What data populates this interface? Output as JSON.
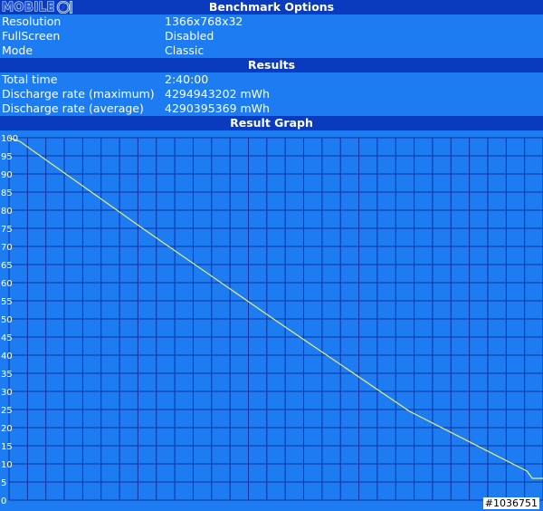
{
  "logo": {
    "text": "MOBILE"
  },
  "benchmark_options": {
    "header": "Benchmark Options",
    "rows": [
      {
        "label": "Resolution",
        "value": "1366x768x32"
      },
      {
        "label": "FullScreen",
        "value": "Disabled"
      },
      {
        "label": "Mode",
        "value": "Classic"
      }
    ]
  },
  "results": {
    "header": "Results",
    "rows": [
      {
        "label": "Total time",
        "value": "2:40:00"
      },
      {
        "label": "Discharge rate (maximum)",
        "value": "4294943202 mWh"
      },
      {
        "label": "Discharge rate (average)",
        "value": "4290395369 mWh"
      }
    ]
  },
  "graph": {
    "header": "Result Graph",
    "watermark": "#1036751"
  },
  "colors": {
    "background": "#1e7cf2",
    "header": "#0a3bbf",
    "grid": "#0d2f9e",
    "line": "#e8f07a"
  },
  "chart_data": {
    "type": "line",
    "title": "Result Graph",
    "xlabel": "",
    "ylabel": "",
    "ylim": [
      0,
      100
    ],
    "yticks": [
      100,
      95,
      90,
      85,
      80,
      75,
      70,
      65,
      60,
      55,
      50,
      45,
      40,
      35,
      30,
      25,
      20,
      15,
      10,
      5,
      0
    ],
    "grid": true,
    "series": [
      {
        "x": [
          0,
          2,
          25,
          50,
          75,
          97,
          98,
          100
        ],
        "y": [
          100,
          99,
          75,
          49.5,
          24.5,
          8,
          6,
          6
        ]
      }
    ]
  }
}
